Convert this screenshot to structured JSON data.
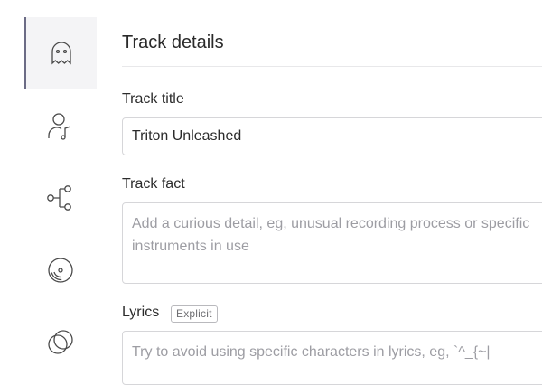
{
  "sidebar": {
    "items": [
      {
        "icon": "ghost-icon",
        "active": true
      },
      {
        "icon": "user-music-icon",
        "active": false
      },
      {
        "icon": "share-nodes-icon",
        "active": false
      },
      {
        "icon": "disc-icon",
        "active": false
      },
      {
        "icon": "overlap-circles-icon",
        "active": false
      }
    ]
  },
  "header": {
    "title": "Track details"
  },
  "form": {
    "track_title": {
      "label": "Track title",
      "value": "Triton Unleashed"
    },
    "track_fact": {
      "label": "Track fact",
      "placeholder": "Add a curious detail, eg, unusual recording process or specific instruments in use"
    },
    "lyrics": {
      "label": "Lyrics",
      "badge": "Explicit",
      "placeholder": "Try to avoid using specific characters in lyrics, eg, `^_{~|"
    }
  },
  "colors": {
    "active_bg": "#f4f4f6",
    "active_border": "#6b6b85",
    "field_border": "#d6d6d9",
    "placeholder": "#9d9da3"
  }
}
